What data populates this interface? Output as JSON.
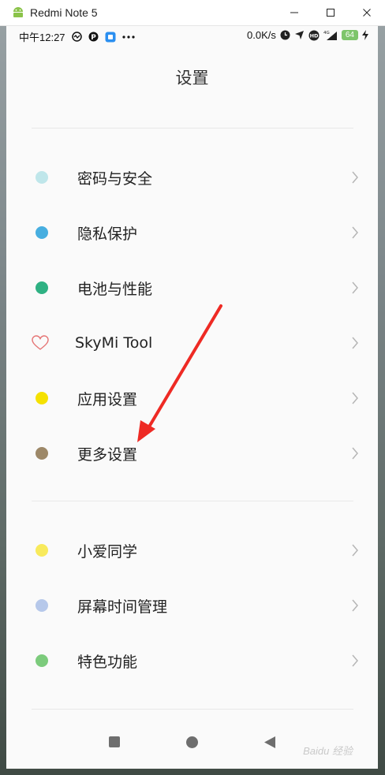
{
  "window": {
    "title": "Redmi Note 5",
    "icon": "android-icon",
    "controls": [
      "minimize-icon",
      "maximize-icon",
      "close-icon"
    ]
  },
  "statusbar": {
    "time": "中午12:27",
    "speed": "0.0K/s",
    "hd": "HD",
    "network": "4G",
    "battery": "64"
  },
  "page": {
    "title": "设置"
  },
  "groups": [
    {
      "items": [
        {
          "label": "密码与安全",
          "icon": "dot-icon",
          "color": "#bfe6ea"
        },
        {
          "label": "隐私保护",
          "icon": "dot-icon",
          "color": "#47aee0"
        },
        {
          "label": "电池与性能",
          "icon": "dot-icon",
          "color": "#2fb183"
        },
        {
          "label": "SkyMi Tool",
          "icon": "heart-outline-icon",
          "color": "#e57373"
        },
        {
          "label": "应用设置",
          "icon": "dot-icon",
          "color": "#f5e100"
        },
        {
          "label": "更多设置",
          "icon": "dot-icon",
          "color": "#9d8868"
        }
      ]
    },
    {
      "items": [
        {
          "label": "小爱同学",
          "icon": "dot-icon",
          "color": "#f8ea5c"
        },
        {
          "label": "屏幕时间管理",
          "icon": "dot-icon",
          "color": "#b6c8ea"
        },
        {
          "label": "特色功能",
          "icon": "dot-icon",
          "color": "#7ccb7c"
        }
      ]
    }
  ],
  "navbar": {
    "buttons": [
      "recents-icon",
      "home-icon",
      "back-icon"
    ]
  },
  "annotation": {
    "color": "#ee2a24"
  },
  "watermark": "Baidu 经验"
}
